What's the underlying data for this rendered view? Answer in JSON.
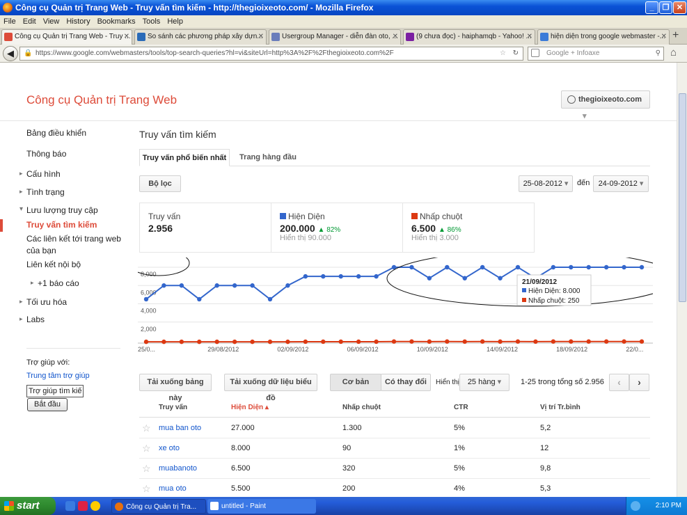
{
  "window": {
    "title": "Công cụ Quản trị Trang Web - Truy vấn tìm kiếm - http://thegioixeoto.com/ - Mozilla Firefox"
  },
  "menu": [
    "File",
    "Edit",
    "View",
    "History",
    "Bookmarks",
    "Tools",
    "Help"
  ],
  "tabs": [
    {
      "label": "Công cụ Quản trị Trang Web - Truy ...",
      "color": "#dd4b39"
    },
    {
      "label": "So sánh các phương pháp xây dựn...",
      "color": "#2a6bb8"
    },
    {
      "label": "Usergroup Manager - diễn đàn oto, ...",
      "color": "#6a7dbb"
    },
    {
      "label": "(9 chưa đọc) - haiphamqb - Yahoo! ...",
      "color": "#7b1fa2"
    },
    {
      "label": "hiện diện trong google webmaster -...",
      "color": "#3b7bd8"
    }
  ],
  "nav": {
    "url": "https://www.google.com/webmasters/tools/top-search-queries?hl=vi&siteUrl=http%3A%2F%2Fthegioixeoto.com%2F",
    "search_placeholder": "Google + Infoaxe"
  },
  "header": {
    "app_name": "Công cụ Quản trị Trang Web",
    "site": "thegioixeoto.com"
  },
  "sidebar": {
    "items": [
      "Bảng điều khiển",
      "Thông báo",
      "Cấu hình",
      "Tình trạng",
      "Lưu lượng truy cập",
      "Truy vấn tìm kiếm",
      "Các liên kết tới trang web",
      "của bạn",
      "Liên kết nội bộ",
      "+1 báo cáo",
      "Tối ưu hóa",
      "Labs"
    ],
    "help_label": "Trợ giúp với:",
    "help_center": "Trung tâm trợ giúp",
    "help_input": "Trợ giúp tìm kiế",
    "help_button": "Bắt đầu"
  },
  "main": {
    "title": "Truy vấn tìm kiếm",
    "tab_active": "Truy vấn phổ biến nhất",
    "tab_other": "Trang hàng đầu",
    "filter": "Bộ lọc",
    "date_from": "25-08-2012",
    "date_to_label": "đến",
    "date_to": "24-09-2012"
  },
  "stats": {
    "queries": {
      "label": "Truy vấn",
      "value": "2.956"
    },
    "impressions": {
      "label": "Hiện Diện",
      "value": "200.000",
      "change": "82%",
      "sub": "Hiển thị 90.000",
      "color": "#3366cc"
    },
    "clicks": {
      "label": "Nhấp chuột",
      "value": "6.500",
      "change": "86%",
      "sub": "Hiển thị 3.000",
      "color": "#dc3912"
    }
  },
  "chart_data": {
    "type": "line",
    "y_ticks": [
      "8,000",
      "6,000",
      "4,000",
      "2,000"
    ],
    "ylim": [
      0,
      8000
    ],
    "x_tick_labels": [
      "25/0...",
      "29/08/2012",
      "02/09/2012",
      "06/09/2012",
      "10/09/2012",
      "14/09/2012",
      "18/09/2012",
      "22/0..."
    ],
    "series": [
      {
        "name": "Hiện Diện",
        "color": "#3366cc",
        "values": [
          4500,
          6000,
          6000,
          4500,
          6000,
          6000,
          6000,
          4500,
          6000,
          7000,
          7000,
          7000,
          7000,
          7000,
          8000,
          8000,
          6800,
          8000,
          6800,
          8000,
          6800,
          8000,
          6800,
          8000,
          8000,
          8000,
          8000,
          8000,
          8000
        ]
      },
      {
        "name": "Nhấp chuột",
        "color": "#dc3912",
        "values": [
          220,
          220,
          220,
          220,
          220,
          220,
          220,
          220,
          220,
          230,
          230,
          230,
          230,
          230,
          250,
          250,
          240,
          250,
          240,
          250,
          240,
          250,
          240,
          250,
          250,
          250,
          250,
          250,
          250
        ]
      }
    ],
    "tooltip": {
      "date": "21/09/2012",
      "impressions_label": "Hiện Diện:",
      "impressions": "8.000",
      "clicks_label": "Nhấp chuột:",
      "clicks": "250"
    }
  },
  "table_controls": {
    "download_table": "Tải xuống bảng này",
    "download_chart": "Tải xuống dữ liệu biểu đồ",
    "basic": "Cơ bản",
    "changes": "Có thay đổi",
    "show_label": "Hiển thị",
    "rows": "25 hàng",
    "range": "1-25 trong tổng số 2.956"
  },
  "table": {
    "headers": [
      "Truy vấn",
      "Hiện Diện ▴",
      "Nhấp chuột",
      "CTR",
      "Vị trí Tr.bình"
    ],
    "rows": [
      [
        "mua ban oto",
        "27.000",
        "1.300",
        "5%",
        "5,2"
      ],
      [
        "xe oto",
        "8.000",
        "90",
        "1%",
        "12"
      ],
      [
        "muabanoto",
        "6.500",
        "320",
        "5%",
        "9,8"
      ],
      [
        "mua oto",
        "5.500",
        "200",
        "4%",
        "5,3"
      ]
    ]
  },
  "taskbar": {
    "start": "start",
    "tasks": [
      "Công cụ Quản trị Tra...",
      "untitled - Paint"
    ],
    "clock": "2:10 PM"
  }
}
